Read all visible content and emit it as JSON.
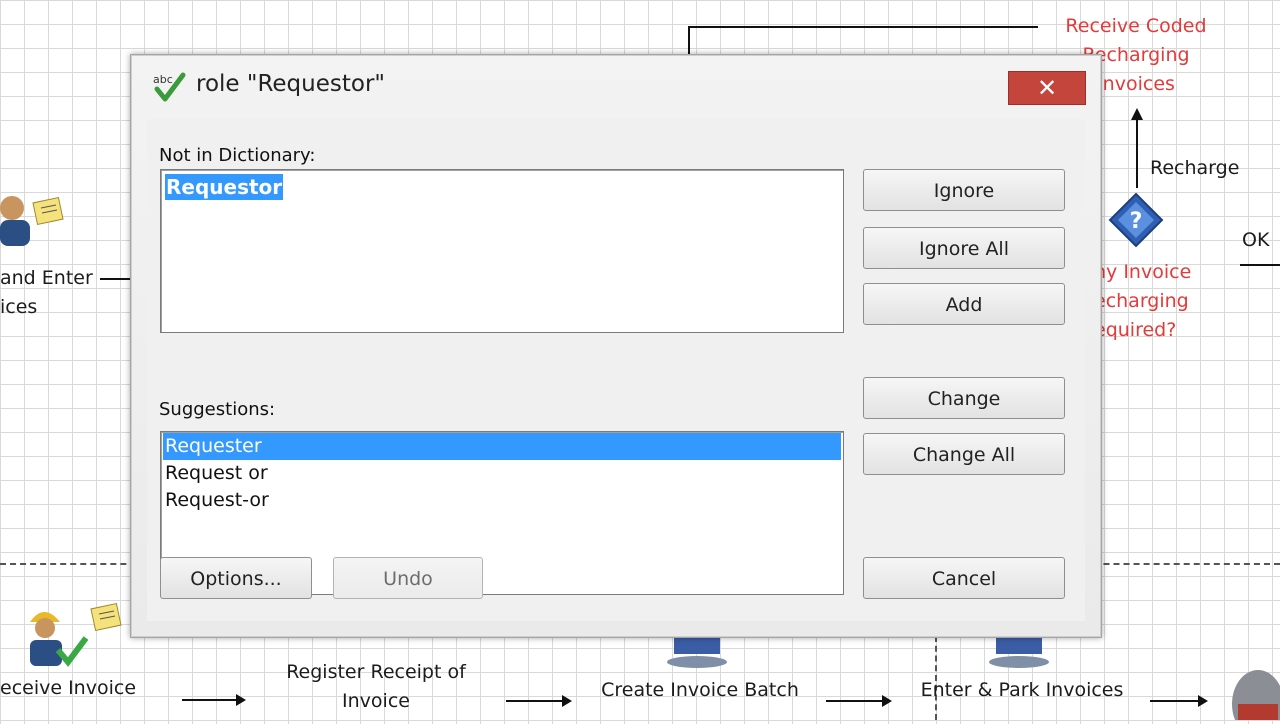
{
  "background": {
    "top_right_lines": [
      "Receive Coded",
      "Recharging",
      "Invoices"
    ],
    "recharge_label": "Recharge",
    "ok_label": "OK",
    "question_lines": [
      "ny Invoice",
      "echarging",
      "equired?"
    ],
    "left_lines": [
      "and Enter",
      "ices"
    ],
    "bottom": {
      "receive_invoice": "eceive Invoice",
      "register_receipt_1": "Register Receipt of",
      "register_receipt_2": "Invoice",
      "create_batch": "Create Invoice Batch",
      "enter_park": "Enter & Park Invoices"
    },
    "colors": {
      "red": "#e33a3a",
      "selection": "#3399ff",
      "close": "#c4453c"
    }
  },
  "dialog": {
    "title": "role \"Requestor\"",
    "close_glyph": "✕",
    "not_in_dictionary_label": "Not in Dictionary:",
    "misspelled_word": "Requestor",
    "suggestions_label": "Suggestions:",
    "suggestions": [
      "Requester",
      "Request or",
      "Request-or"
    ],
    "selected_suggestion_index": 0,
    "buttons": {
      "ignore": "Ignore",
      "ignore_all": "Ignore All",
      "add": "Add",
      "change": "Change",
      "change_all": "Change All",
      "options": "Options...",
      "undo": "Undo",
      "cancel": "Cancel"
    },
    "icons": {
      "title": "spellcheck-icon",
      "close": "close-icon"
    }
  }
}
